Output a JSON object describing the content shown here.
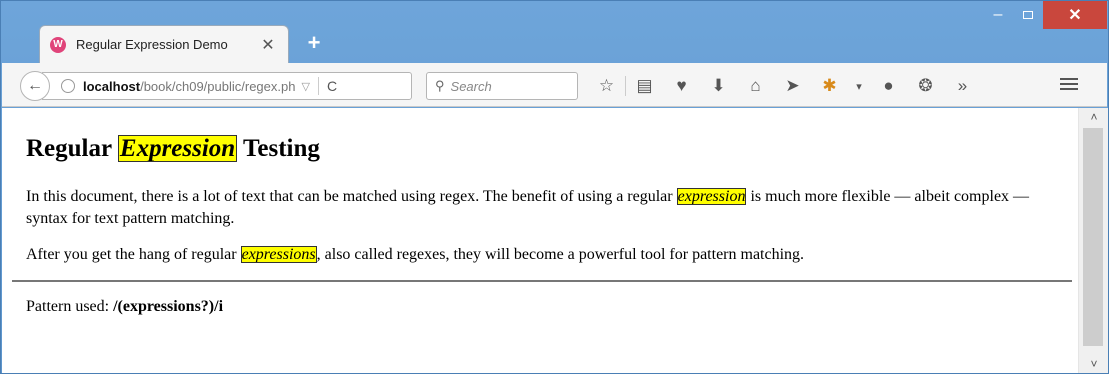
{
  "window": {
    "tab_title": "Regular Expression Demo",
    "tab_favicon": "W",
    "tab_close": "✕",
    "new_tab": "+",
    "minimize": "–",
    "close": "✕"
  },
  "toolbar": {
    "back": "←",
    "url_host": "localhost",
    "url_path": "/book/ch09/public/regex.ph",
    "url_dropdown": "▽",
    "reload": "C",
    "search_placeholder": "Search",
    "icons": [
      "star-icon",
      "reading-list-icon",
      "pocket-icon",
      "download-icon",
      "home-icon",
      "send-icon",
      "extension-icon",
      "dropdown-icon",
      "chat-icon",
      "addon-icon",
      "overflow-icon"
    ]
  },
  "page": {
    "heading_pre": "Regular ",
    "heading_match": "Expression",
    "heading_post": " Testing",
    "p1_pre": "In this document, there is a lot of text that can be matched using regex. The benefit of using a regular ",
    "p1_match": "expression",
    "p1_post": " is much more flexible — albeit complex — syntax for text pattern matching.",
    "p2_pre": "After you get the hang of regular ",
    "p2_match": "expressions",
    "p2_post": ", also called regexes, they will become a powerful tool for pattern matching.",
    "pattern_label": "Pattern used: ",
    "pattern_value": "/(expressions?)/i"
  },
  "colors": {
    "highlight": "#ffff00",
    "titlebar": "#6fa4d8",
    "close_button": "#c9473d"
  }
}
